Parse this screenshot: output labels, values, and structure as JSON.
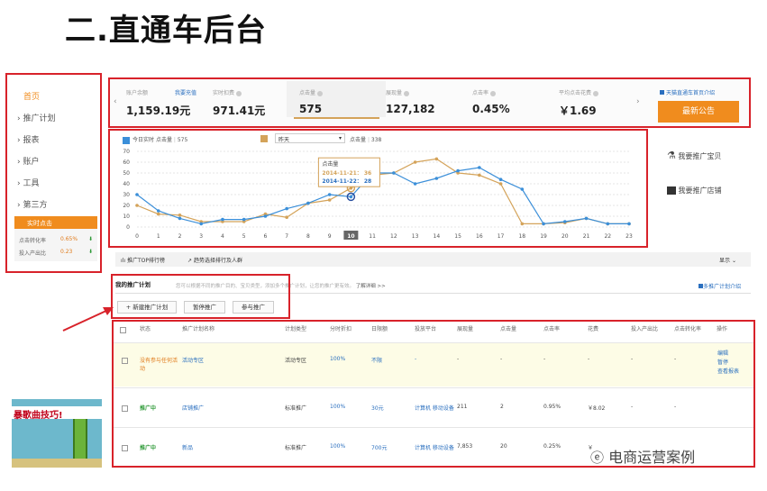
{
  "title": "二.直通车后台",
  "sidebar": {
    "items": [
      {
        "label": "首页"
      },
      {
        "label": "› 推广计划"
      },
      {
        "label": "› 报表"
      },
      {
        "label": "› 账户"
      },
      {
        "label": "› 工具"
      },
      {
        "label": "› 第三方"
      }
    ],
    "realtime": {
      "title": "实时点击",
      "rows": [
        {
          "label": "点击转化率",
          "value": "0.65%"
        },
        {
          "label": "投入产出比",
          "value": "0.23"
        }
      ]
    }
  },
  "stats": {
    "balance_label": "账户余额",
    "recharge": "我要充值",
    "balance": "1,159.19元",
    "spend_label": "实时扣费",
    "spend": "971.41元",
    "clicks_label": "点击量",
    "clicks": "575",
    "impr_label": "展现量",
    "impressions": "127,182",
    "ctr_label": "点击率",
    "ctr": "0.45%",
    "cpc_label": "平均点击花费",
    "cpc": "￥1.69",
    "tmall_link": "天猫直通车首页介绍",
    "announce": "最新公告"
  },
  "legend": {
    "today": "今日实时",
    "today_metric": "点击量",
    "today_value": "575",
    "compare": "昨天",
    "compare_metric": "点击量",
    "compare_value": "338"
  },
  "chart_data": {
    "type": "line",
    "x": [
      0,
      1,
      2,
      3,
      4,
      5,
      6,
      7,
      8,
      9,
      10,
      11,
      12,
      13,
      14,
      15,
      16,
      17,
      18,
      19,
      20,
      21,
      22,
      23
    ],
    "ylim": [
      0,
      70
    ],
    "yticks": [
      0,
      10,
      20,
      30,
      40,
      50,
      60,
      70
    ],
    "highlight_x": 10,
    "series": [
      {
        "name": "今日实时",
        "color": "#3b8fd9",
        "values": [
          30,
          15,
          8,
          3,
          7,
          7,
          10,
          17,
          22,
          30,
          28,
          50,
          50,
          40,
          45,
          52,
          55,
          44,
          35,
          3,
          5,
          8,
          3,
          3
        ]
      },
      {
        "name": "昨天",
        "color": "#d4a35a",
        "values": [
          20,
          12,
          11,
          5,
          5,
          5,
          12,
          9,
          22,
          25,
          36,
          48,
          50,
          60,
          63,
          50,
          48,
          40,
          3,
          3,
          4,
          8,
          3,
          3
        ]
      }
    ],
    "tooltip": {
      "title": "点击量",
      "line1_date": "2014-11-21：",
      "line1_value": "36",
      "line2_date": "2014-11-22：",
      "line2_value": "28"
    }
  },
  "right_links": {
    "item": "我要推广宝贝",
    "shop": "我要推广店铺"
  },
  "tabs": {
    "top": "推广TOP排行榜",
    "rank": "趋势选择排行及人群",
    "show": "显示"
  },
  "campaign": {
    "tab": "我的推广计划",
    "hint": "您可以根据不同的推广目的、宝贝类型，添加多个推广计划，让您的推广更有效。",
    "learn_more": "了解详细 >>",
    "more_plans": "多推广计划介绍",
    "new_btn": "+ 新建推广计划",
    "pause_btn": "暂停推广",
    "join_btn": "参与推广"
  },
  "table": {
    "headers": [
      "状态",
      "推广计划名称",
      "计划类型",
      "分时折扣",
      "日限额",
      "投放平台",
      "展现量",
      "点击量",
      "点击率",
      "花费",
      "投入产出比",
      "点击转化率",
      "操作"
    ],
    "rows": [
      {
        "status": "没有参与任何活动",
        "name": "活动专区",
        "type": "活动专区",
        "discount": "100%",
        "limit": "不限",
        "platform": "-",
        "impr": "-",
        "clicks": "-",
        "ctr": "-",
        "cost": "-",
        "roi": "-",
        "cvr": "-",
        "op1": "编辑",
        "op2": "暂停",
        "op3": "查看报表"
      },
      {
        "status": "推广中",
        "name": "店铺推广",
        "type": "标准推广",
        "discount": "100%",
        "limit": "30元",
        "platform": "计算机 移动设备",
        "impr": "211",
        "clicks": "2",
        "ctr": "0.95%",
        "cost": "￥8.02",
        "roi": "-",
        "cvr": "-"
      },
      {
        "status": "推广中",
        "name": "新品",
        "type": "标准推广",
        "discount": "100%",
        "limit": "700元",
        "platform": "计算机 移动设备",
        "impr": "7,853",
        "clicks": "20",
        "ctr": "0.25%",
        "cost": "￥",
        "roi": "",
        "cvr": ""
      }
    ]
  },
  "game_text": "暴歌曲技巧!",
  "watermark": "电商运营案例"
}
